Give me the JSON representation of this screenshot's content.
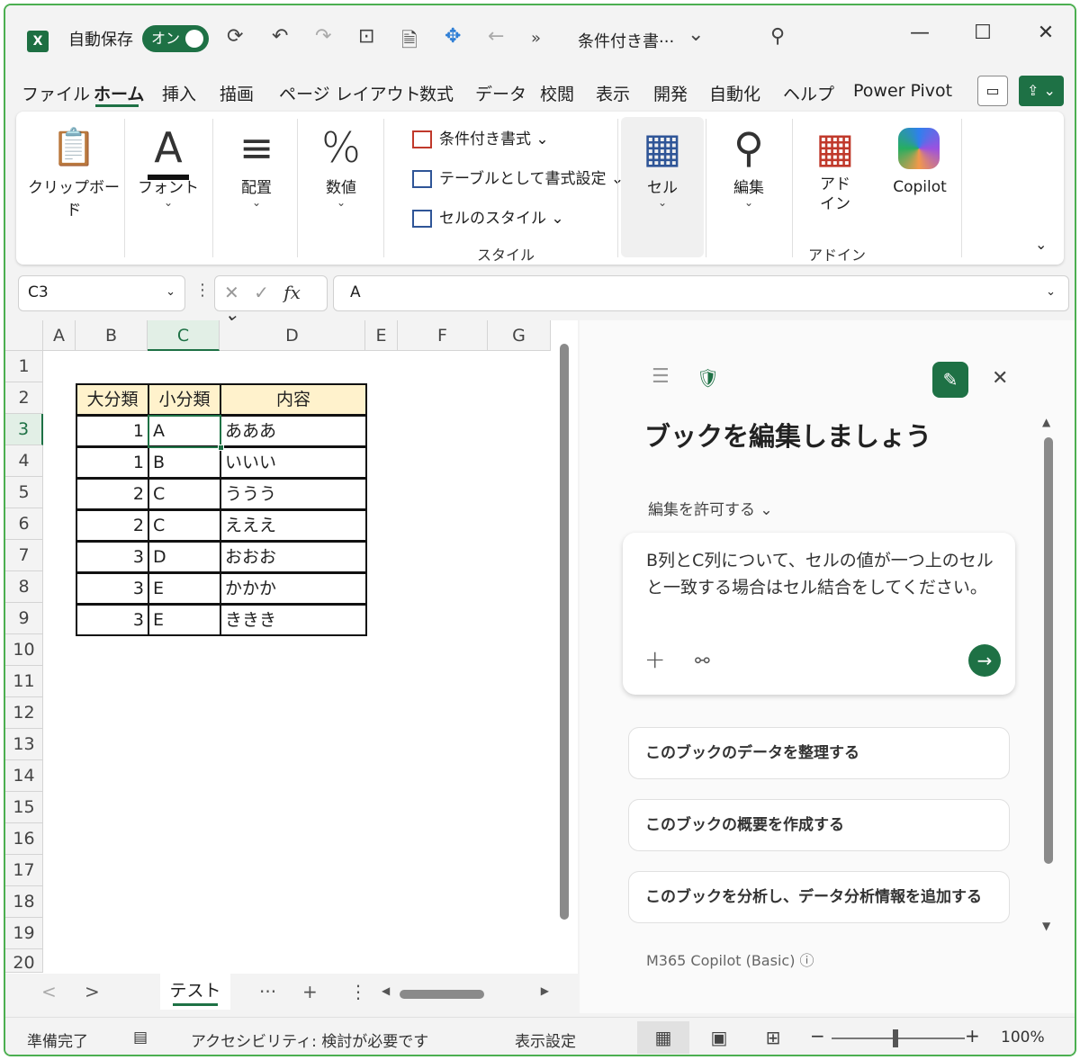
{
  "titlebar": {
    "autosave_label": "自動保存",
    "autosave_state": "オン",
    "file_title": "条件付き書···",
    "icons": {
      "logo": "X",
      "save": "⟳",
      "undo": "↶",
      "redo": "↷",
      "new_sheet": "⊡",
      "document": "🗎",
      "addin": "✥",
      "back": "←",
      "more": "»",
      "title_dropdown": "⌄",
      "search": "⚲",
      "minimize": "—",
      "maximize": "☐",
      "close": "✕"
    }
  },
  "menu": {
    "items": [
      {
        "label": "ファイル"
      },
      {
        "label": "ホーム"
      },
      {
        "label": "挿入"
      },
      {
        "label": "描画"
      },
      {
        "label": "ページ レイアウト"
      },
      {
        "label": "数式"
      },
      {
        "label": "データ"
      },
      {
        "label": "校閲"
      },
      {
        "label": "表示"
      },
      {
        "label": "開発"
      },
      {
        "label": "自動化"
      },
      {
        "label": "ヘルプ"
      },
      {
        "label": "Power Pivot"
      }
    ],
    "comment_icon": "▭",
    "share_icon": "⇪ ⌄"
  },
  "ribbon": {
    "clipboard": {
      "label": "クリップボード",
      "icon": "📋",
      "chevron": "⌄"
    },
    "font": {
      "label": "フォント",
      "icon": "A",
      "chevron": "⌄"
    },
    "alignment": {
      "label": "配置",
      "icon": "≡",
      "chevron": "⌄"
    },
    "number": {
      "label": "数値",
      "icon": "%",
      "chevron": "⌄"
    },
    "styles": {
      "conditional": "条件付き書式 ⌄",
      "as_table": "テーブルとして書式設定 ⌄",
      "cell_styles": "セルのスタイル ⌄",
      "caption": "スタイル"
    },
    "cells": {
      "label": "セル",
      "icon": "▦",
      "chevron": "⌄"
    },
    "editing": {
      "label": "編集",
      "icon": "⚲",
      "chevron": "⌄"
    },
    "addins": {
      "label_line1": "アド",
      "label_line2": "イン",
      "icon": "▦",
      "caption": "アドイン"
    },
    "copilot": {
      "label": "Copilot"
    },
    "collapse": "⌄"
  },
  "formula_bar": {
    "name_box": "C3",
    "name_dropdown": "⌄",
    "more": "⋮",
    "cancel": "✕",
    "enter": "✓",
    "fx": "fx ⌄",
    "value": "A",
    "expand": "⌄"
  },
  "grid": {
    "columns": [
      "A",
      "B",
      "C",
      "D",
      "E",
      "F",
      "G"
    ],
    "rows": [
      "1",
      "2",
      "3",
      "4",
      "5",
      "6",
      "7",
      "8",
      "9",
      "10",
      "11",
      "12",
      "13",
      "14",
      "15",
      "16",
      "17",
      "18",
      "19",
      "20"
    ],
    "table_header": [
      "大分類",
      "小分類",
      "内容"
    ],
    "table_rows": [
      [
        "1",
        "A",
        "あああ"
      ],
      [
        "1",
        "B",
        "いいい"
      ],
      [
        "2",
        "C",
        "ううう"
      ],
      [
        "2",
        "C",
        "えええ"
      ],
      [
        "3",
        "D",
        "おおお"
      ],
      [
        "3",
        "E",
        "かかか"
      ],
      [
        "3",
        "E",
        "ききき"
      ]
    ],
    "active_cell": "C3"
  },
  "sheets": {
    "prev": "<",
    "next": ">",
    "tab": "テスト",
    "more": "···",
    "add": "+",
    "options": "⋮",
    "scroll_left": "◀",
    "scroll_right": "▶"
  },
  "copilot_pane": {
    "menu_icon": "☰",
    "shield_icon": "🛡",
    "edit_icon": "✎",
    "close_icon": "✕",
    "title": "ブックを編集しましょう",
    "allow_edit": "編集を許可する ⌄",
    "prompt": "B列とC列について、セルの値が一つ上のセルと一致する場合はセル結合をしてください。",
    "attach_icon": "+",
    "link_icon": "⚯",
    "send_icon": "→",
    "suggestions": [
      "このブックのデータを整理する",
      "このブックの概要を作成する",
      "このブックを分析し、データ分析情報を追加する"
    ],
    "footer": "M365 Copilot (Basic) ⓘ",
    "scroll_up": "▲",
    "scroll_down": "▼"
  },
  "status": {
    "ready": "準備完了",
    "macro_icon": "▤",
    "accessibility": "アクセシビリティ: 検討が必要です",
    "display_settings": "表示設定",
    "view_normal": "▦",
    "view_page_layout": "▣",
    "view_page_break": "⊞",
    "zoom_out": "−",
    "zoom_in": "+",
    "zoom": "100%"
  }
}
